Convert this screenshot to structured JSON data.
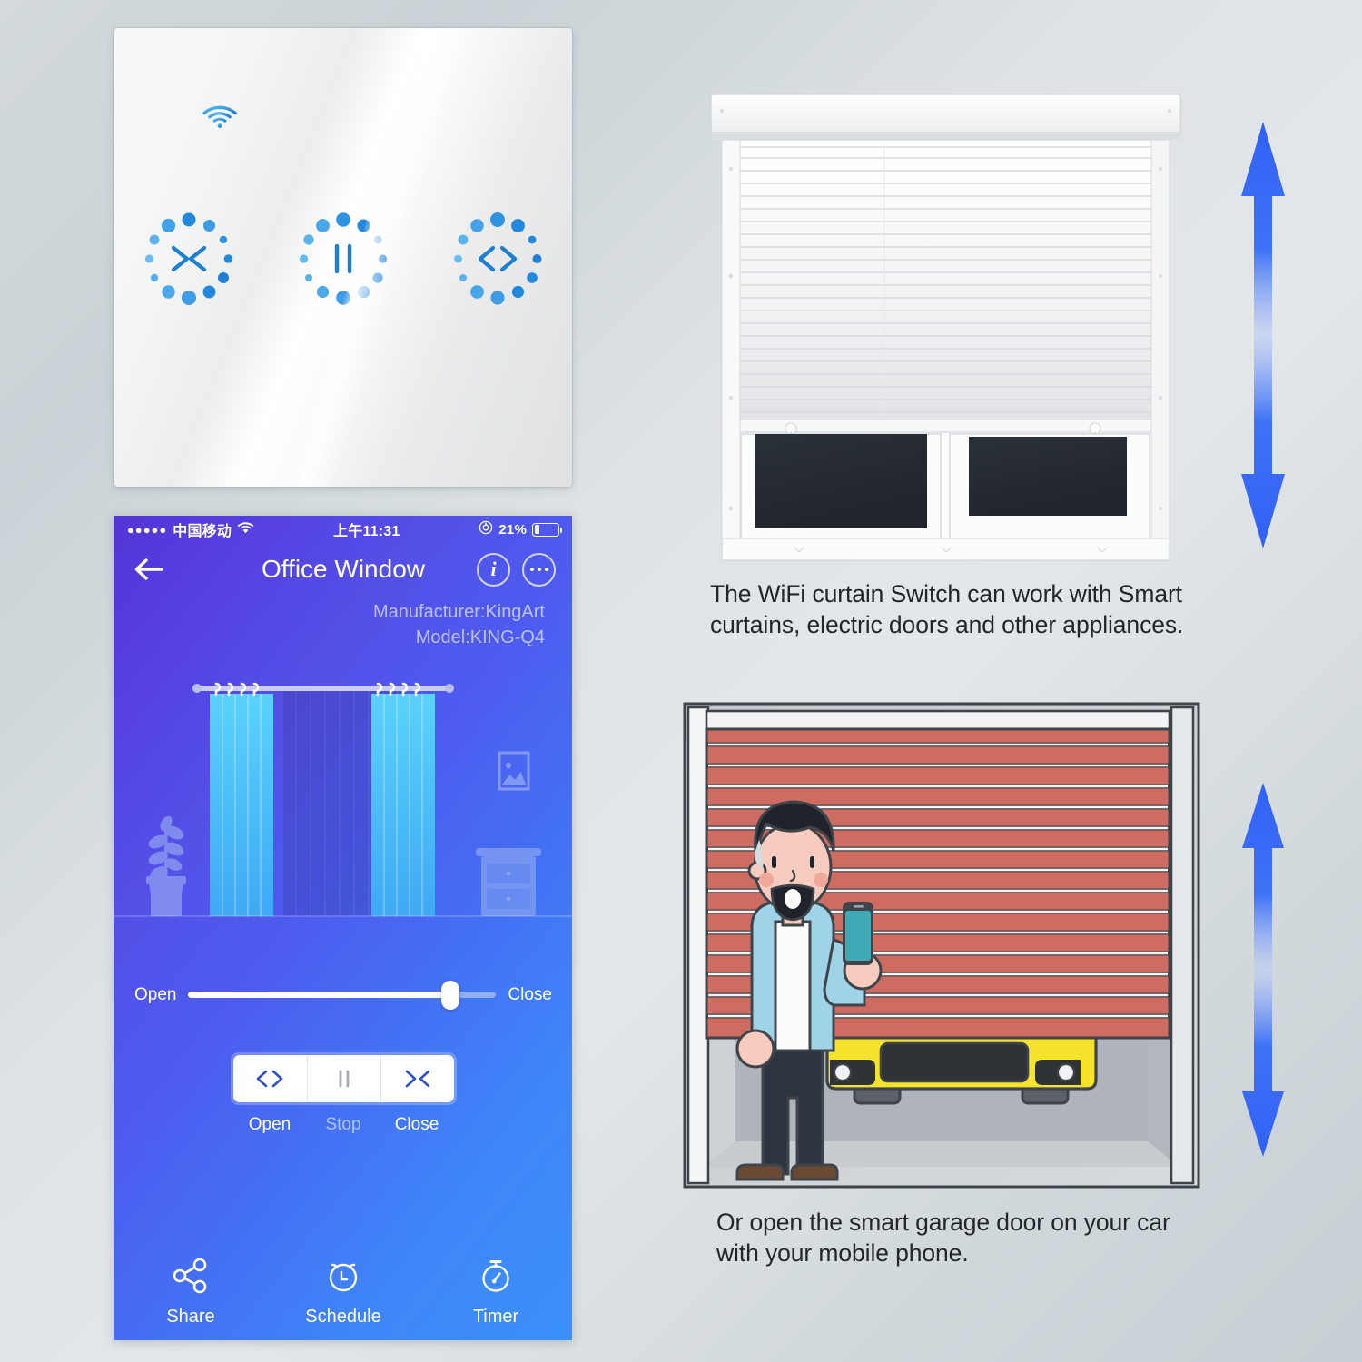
{
  "colors": {
    "accent_blue": "#2a7fe0",
    "brand_blue": "#3d8bfd",
    "phone_gradient_start": "#5535d6",
    "phone_gradient_end": "#3b90fa",
    "arrow_blue": "#3d6ef5",
    "garage_door_red": "#cf6c62",
    "car_yellow": "#f5e32b",
    "shutter_white": "#f4f5f6",
    "background_grey": "#d7dde0",
    "caption_text": "#22262b"
  },
  "switch_panel": {
    "wifi_icon": "wifi-icon",
    "keys": [
      {
        "name": "close-key",
        "glyph": "close-arrows",
        "icon_name": "close-icon"
      },
      {
        "name": "stop-key",
        "glyph": "pause-bars",
        "icon_name": "stop-icon"
      },
      {
        "name": "open-key",
        "glyph": "open-arrows",
        "icon_name": "open-icon"
      }
    ]
  },
  "phone": {
    "status_bar": {
      "signal_dots": "●●●●●",
      "carrier": "中国移动",
      "wifi_icon": "wifi-icon",
      "time": "上午11:31",
      "lock_icon": "rotation-lock-icon",
      "battery_percent": "21%",
      "battery_level": 21
    },
    "nav": {
      "back_icon": "back-arrow-icon",
      "title": "Office Window",
      "info_label": "i",
      "info_icon": "info-icon",
      "more_icon": "more-dots-icon"
    },
    "device_meta": {
      "manufacturer": "Manufacturer:KingArt",
      "model": "Model:KING-Q4"
    },
    "scene": {
      "plant_icon": "potted-plant-icon",
      "picture_frame_icon": "picture-frame-icon",
      "nightstand_icon": "nightstand-icon",
      "curtain_rod_icon": "curtain-rod-icon",
      "curtain_left_icon": "curtain-panel-left-icon",
      "curtain_right_icon": "curtain-panel-right-icon"
    },
    "slider": {
      "left_label": "Open",
      "right_label": "Close",
      "value_percent": 85
    },
    "controls": [
      {
        "label": "Open",
        "icon_name": "open-icon",
        "glyph": "open-arrows",
        "muted": false
      },
      {
        "label": "Stop",
        "icon_name": "stop-icon",
        "glyph": "pause-bars",
        "muted": true
      },
      {
        "label": "Close",
        "icon_name": "close-icon",
        "glyph": "close-arrows",
        "muted": false
      }
    ],
    "toolbar": [
      {
        "label": "Share",
        "icon_name": "share-icon"
      },
      {
        "label": "Schedule",
        "icon_name": "alarm-clock-icon",
        "clock_letter": "L"
      },
      {
        "label": "Timer",
        "icon_name": "stopwatch-icon"
      }
    ]
  },
  "shutter_section": {
    "illustration": "roller-shutter-window",
    "arrow_icon": "double-arrow-vertical-icon",
    "caption": "The WiFi curtain Switch can work with Smart curtains, electric doors and other appliances."
  },
  "garage_section": {
    "illustration": "garage-door-with-man-and-car",
    "arrow_icon": "double-arrow-vertical-icon",
    "caption": "Or open the smart garage door on your car with your mobile phone."
  }
}
